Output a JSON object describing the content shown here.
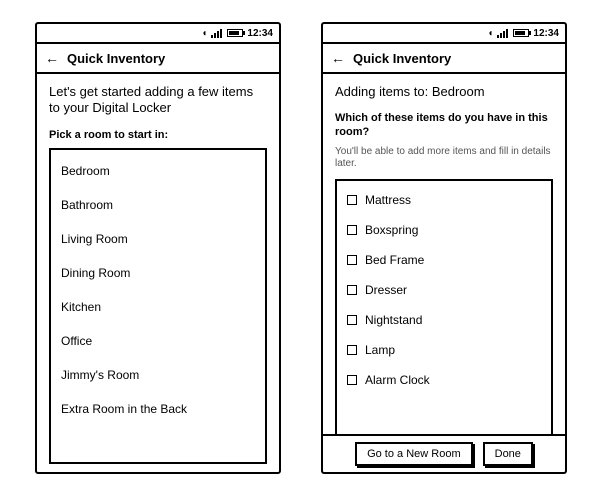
{
  "status": {
    "time": "12:34"
  },
  "app": {
    "title": "Quick Inventory"
  },
  "screen1": {
    "intro": "Let's get started adding a few items to your Digital Locker",
    "subhead": "Pick a room to start in:",
    "rooms": [
      "Bedroom",
      "Bathroom",
      "Living Room",
      "Dining Room",
      "Kitchen",
      "Office",
      "Jimmy's Room",
      "Extra Room in the Back"
    ]
  },
  "screen2": {
    "intro": "Adding items to: Bedroom",
    "subhead": "Which of these items do you have in this room?",
    "hint": "You'll be able to add more items and fill in details later.",
    "items": [
      "Mattress",
      "Boxspring",
      "Bed Frame",
      "Dresser",
      "Nightstand",
      "Lamp",
      "Alarm Clock"
    ],
    "buttons": {
      "new_room": "Go to a New Room",
      "done": "Done"
    }
  }
}
